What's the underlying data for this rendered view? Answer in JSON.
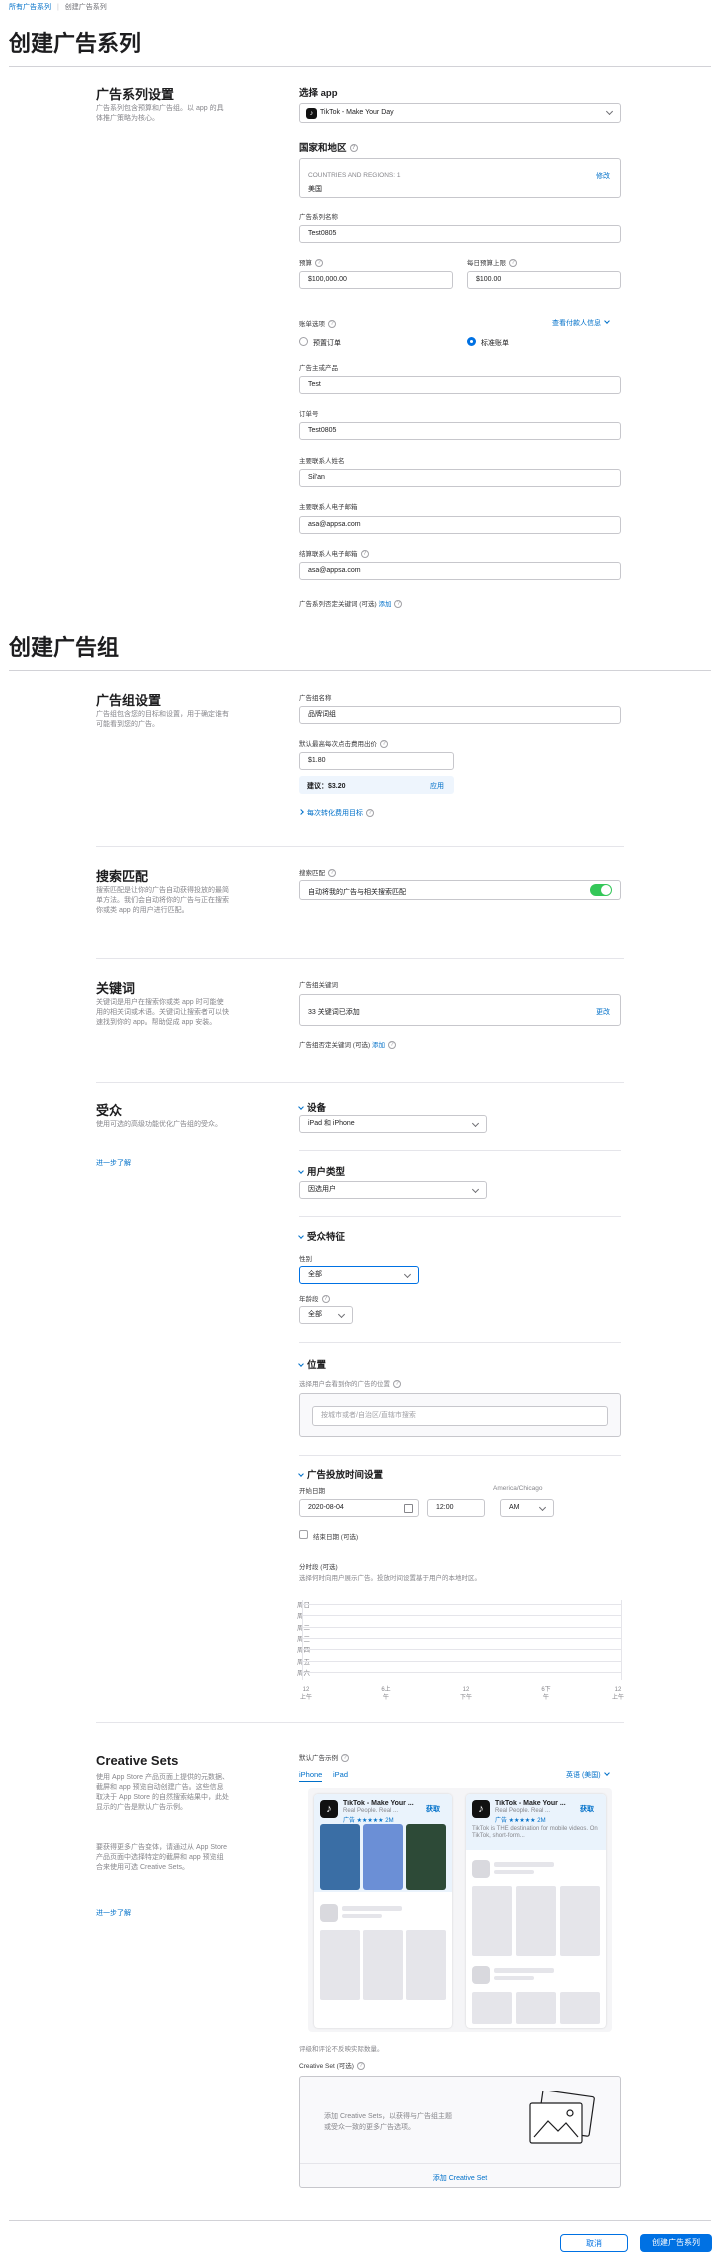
{
  "breadcrumb": {
    "root": "所有广告系列",
    "sep": "|",
    "current": "创建广告系列"
  },
  "campaign": {
    "page_title": "创建广告系列",
    "section_title": "广告系列设置",
    "section_desc": "广告系列包含预算和广告组。以 app 的具体推广策略为核心。",
    "choose_app_label": "选择 app",
    "app_name": "TikTok - Make Your Day",
    "countries_label": "国家和地区",
    "countries_caption": "COUNTRIES AND REGIONS: 1",
    "countries_value": "美国",
    "countries_edit": "修改",
    "name_label": "广告系列名称",
    "name_value": "Test0805",
    "budget_label": "预算",
    "budget_value": "$100,000.00",
    "daily_cap_label": "每日预算上限",
    "daily_cap_value": "$100.00",
    "billing_label": "账单选项",
    "billing_link": "查看付款人信息",
    "billing_opt1": "预置订单",
    "billing_opt2": "标准账单",
    "advertiser_label": "广告主或产品",
    "advertiser_value": "Test",
    "order_label": "订单号",
    "order_value": "Test0805",
    "contact_name_label": "主要联系人姓名",
    "contact_name_value": "Sil'an",
    "contact_email_label": "主要联系人电子邮箱",
    "contact_email_value": "asa@appsa.com",
    "billing_email_label": "结算联系人电子邮箱",
    "billing_email_value": "asa@appsa.com",
    "negative_kw_label": "广告系列否定关键词 (可选)",
    "negative_kw_add": "添加"
  },
  "adgroup": {
    "page_title": "创建广告组",
    "section_title": "广告组设置",
    "section_desc": "广告组包含您的目标和设置，用于确定谁有可能看到您的广告。",
    "name_label": "广告组名称",
    "name_value": "品牌词组",
    "cpt_label": "默认最高每次点击费用出价",
    "cpt_value": "$1.80",
    "suggest_label": "建议：",
    "suggest_value": "$3.20",
    "suggest_apply": "应用",
    "cpa_link": "每次转化费用目标"
  },
  "search_match": {
    "section_title": "搜索匹配",
    "section_desc": "搜索匹配是让你的广告自动获得投放的最简单方法。我们会自动将你的广告与正在搜索你或类 app 的用户进行匹配。",
    "label": "搜索匹配",
    "toggle_text": "自动将我的广告与相关搜索匹配"
  },
  "keywords": {
    "section_title": "关键词",
    "section_desc": "关键词是用户在搜索你或类 app 时可能使用的相关词或术语。关键词让搜索者可以快速找到你的 app。帮助促成 app 安装。",
    "label": "广告组关键词",
    "added_text": "33 关键词已添加",
    "edit": "更改",
    "negative_label": "广告组否定关键词 (可选)",
    "negative_add": "添加"
  },
  "audience": {
    "section_title": "受众",
    "section_desc": "使用可选的高级功能优化广告组的受众。",
    "learn_more": "进一步了解",
    "devices_title": "设备",
    "devices_value": "iPad 和 iPhone",
    "user_type_title": "用户类型",
    "user_type_value": "因选用户",
    "traits_title": "受众特征",
    "gender_label": "性别",
    "gender_value": "全部",
    "age_label": "年龄段",
    "age_value": "全部",
    "location_title": "位置",
    "location_desc": "选择用户会看到你的广告的位置",
    "location_placeholder": "按城市或者/自治区/直辖市搜索"
  },
  "schedule": {
    "title": "广告投放时间设置",
    "start_label": "开始日期",
    "tz_label": "America/Chicago",
    "start_date": "2020-08-04",
    "start_time": "12:00",
    "ampm": "AM",
    "end_date_label": "结束日期 (可选)",
    "dayparting_label": "分时段 (可选)",
    "dayparting_desc": "选择何时向用户展示广告。投放时间设置基于用户的本地时区。",
    "days": [
      "周日",
      "周一",
      "周二",
      "周三",
      "周四",
      "周五",
      "周六"
    ],
    "hours": [
      {
        "num": "12",
        "ap": "上午"
      },
      {
        "num": "6上",
        "ap": "午"
      },
      {
        "num": "12",
        "ap": "下午"
      },
      {
        "num": "6下",
        "ap": "午"
      },
      {
        "num": "12",
        "ap": "上午"
      }
    ]
  },
  "creative": {
    "section_title": "Creative Sets",
    "section_desc": "使用 App Store 产品页面上提供的元数据、截屏和 app 预览自动创建广告。这些信息取决于 App Store 的自然搜索结果中，此处显示的广告是默认广告示例。",
    "section_desc2": "要获得更多广告变体，请通过从 App Store 产品页面中选择特定的截屏和 app 预览组合来使用可选 Creative Sets。",
    "learn_more": "进一步了解",
    "default_label": "默认广告示例",
    "tab_iphone": "iPhone",
    "tab_ipad": "iPad",
    "lang": "英语 (美国)",
    "preview1_title": "TikTok - Make Your ...",
    "preview1_sub": "Real People. Real ...",
    "preview1_ad": "广告 ★★★★★ 2M",
    "preview2_title": "TikTok - Make Your ...",
    "preview2_sub": "Real People. Real ...",
    "preview2_ad": "广告 ★★★★★ 2M",
    "preview2_desc": "TikTok is THE destination for mobile videos. On TikTok, short-form...",
    "get": "获取",
    "note": "评级和评论不反映实际数量。",
    "cs_label": "Creative Set (可选)",
    "cs_desc": "添加 Creative Sets，以获得与广告组主题或受众一致的更多广告选项。",
    "cs_add": "添加 Creative Set"
  },
  "footer": {
    "cancel": "取消",
    "create": "创建广告系列"
  }
}
